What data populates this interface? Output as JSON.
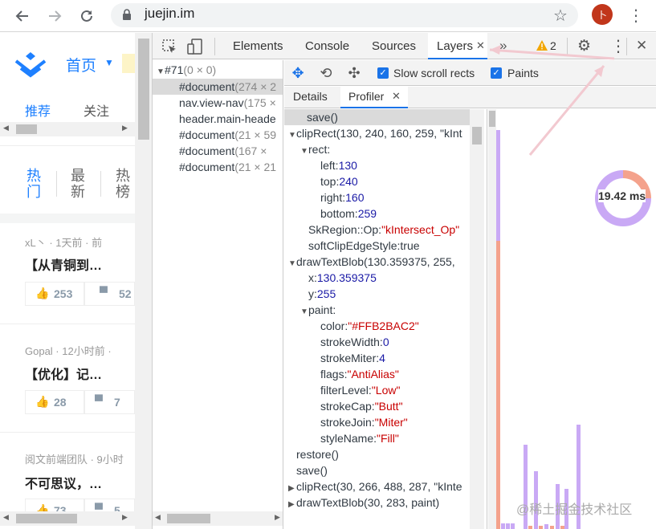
{
  "browser": {
    "url": "juejin.im",
    "avatar_letter": "卜",
    "back_icon": "back-arrow-icon",
    "forward_icon": "forward-arrow-icon",
    "reload_icon": "reload-icon"
  },
  "page": {
    "home_label": "首页",
    "tabs": [
      "推荐",
      "关注"
    ],
    "sort_tabs": [
      "热门",
      "最新",
      "热榜"
    ],
    "articles": [
      {
        "meta": "xL丶 · 1天前 · 前",
        "title": "【从青铜到…",
        "likes": "253",
        "comments": "52"
      },
      {
        "meta": "Gopal · 12小时前 ·",
        "title": "【优化】记…",
        "likes": "28",
        "comments": "7"
      },
      {
        "meta": "阅文前端团队 · 9小时",
        "title": "不可思议，…",
        "likes": "73",
        "comments": "5"
      }
    ]
  },
  "devtools": {
    "tabs": [
      "Elements",
      "Console",
      "Sources",
      "Layers"
    ],
    "active_tab": "Layers",
    "warning_count": "2",
    "more_tabs": "»",
    "tree": {
      "root": "#71",
      "root_size": "(0 × 0)",
      "rows": [
        {
          "name": "#document",
          "size": "(274 × 2"
        },
        {
          "name": "nav.view-nav",
          "size": "(175 ×"
        },
        {
          "name": "header.main-heade",
          "size": ""
        },
        {
          "name": "#document",
          "size": "(21 × 59"
        },
        {
          "name": "#document",
          "size": "(167 ×"
        },
        {
          "name": "#document",
          "size": "(21 × 21"
        }
      ]
    },
    "layers_toolbar": {
      "slow_scroll": "Slow scroll rects",
      "paints": "Paints"
    },
    "sub_tabs": [
      "Details",
      "Profiler"
    ],
    "active_sub_tab": "Profiler",
    "timing": "19.42 ms",
    "watermark": "@稀土掘金技术社区"
  },
  "log": [
    {
      "indent": 0,
      "arrow": "",
      "key": "save()",
      "val": "",
      "vt": ""
    },
    {
      "indent": 0,
      "arrow": "▼",
      "key": "clipRect(130, 240, 160, 259, \"kInt",
      "val": "",
      "vt": ""
    },
    {
      "indent": 1,
      "arrow": "▼",
      "key": "rect:",
      "val": "",
      "vt": ""
    },
    {
      "indent": 2,
      "arrow": "",
      "key": "left:",
      "val": "130",
      "vt": "n"
    },
    {
      "indent": 2,
      "arrow": "",
      "key": "top:",
      "val": "240",
      "vt": "n"
    },
    {
      "indent": 2,
      "arrow": "",
      "key": "right:",
      "val": "160",
      "vt": "n"
    },
    {
      "indent": 2,
      "arrow": "",
      "key": "bottom:",
      "val": "259",
      "vt": "n"
    },
    {
      "indent": 1,
      "arrow": "",
      "key": "SkRegion::Op:",
      "val": "\"kIntersect_Op\"",
      "vt": "s"
    },
    {
      "indent": 1,
      "arrow": "",
      "key": "softClipEdgeStyle:",
      "val": "true",
      "vt": "k"
    },
    {
      "indent": 0,
      "arrow": "▼",
      "key": "drawTextBlob(130.359375, 255, ",
      "val": "",
      "vt": ""
    },
    {
      "indent": 1,
      "arrow": "",
      "key": "x:",
      "val": "130.359375",
      "vt": "n"
    },
    {
      "indent": 1,
      "arrow": "",
      "key": "y:",
      "val": "255",
      "vt": "n"
    },
    {
      "indent": 1,
      "arrow": "▼",
      "key": "paint:",
      "val": "",
      "vt": ""
    },
    {
      "indent": 2,
      "arrow": "",
      "key": "color:",
      "val": "\"#FFB2BAC2\"",
      "vt": "s"
    },
    {
      "indent": 2,
      "arrow": "",
      "key": "strokeWidth:",
      "val": "0",
      "vt": "n"
    },
    {
      "indent": 2,
      "arrow": "",
      "key": "strokeMiter:",
      "val": "4",
      "vt": "n"
    },
    {
      "indent": 2,
      "arrow": "",
      "key": "flags:",
      "val": "\"AntiAlias\"",
      "vt": "s"
    },
    {
      "indent": 2,
      "arrow": "",
      "key": "filterLevel:",
      "val": "\"Low\"",
      "vt": "s"
    },
    {
      "indent": 2,
      "arrow": "",
      "key": "strokeCap:",
      "val": "\"Butt\"",
      "vt": "s"
    },
    {
      "indent": 2,
      "arrow": "",
      "key": "strokeJoin:",
      "val": "\"Miter\"",
      "vt": "s"
    },
    {
      "indent": 2,
      "arrow": "",
      "key": "styleName:",
      "val": "\"Fill\"",
      "vt": "s"
    },
    {
      "indent": 0,
      "arrow": "",
      "key": "restore()",
      "val": "",
      "vt": ""
    },
    {
      "indent": 0,
      "arrow": "",
      "key": "save()",
      "val": "",
      "vt": ""
    },
    {
      "indent": 0,
      "arrow": "▶",
      "key": "clipRect(30, 266, 488, 287, \"kInte",
      "val": "",
      "vt": ""
    },
    {
      "indent": 0,
      "arrow": "▶",
      "key": "drawTextBlob(30, 283, paint)",
      "val": "",
      "vt": ""
    }
  ],
  "colors": {
    "accent": "#1e80ff",
    "purple": "#c9a9f5",
    "orange": "#f4a28c"
  }
}
